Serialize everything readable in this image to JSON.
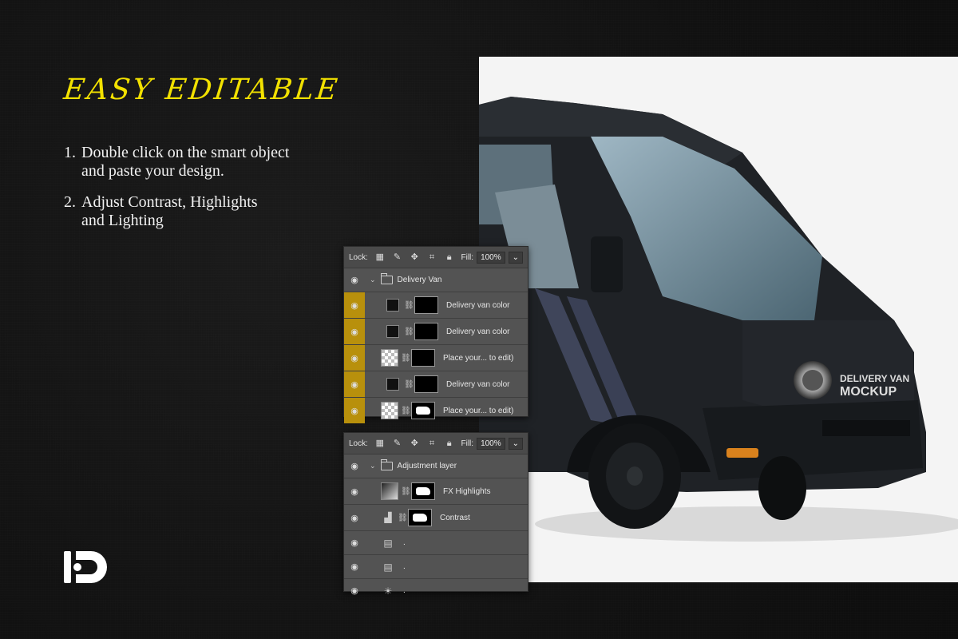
{
  "heading": "EASY EDITABLE",
  "steps": [
    {
      "num": "1.",
      "line1": "Double click on the smart object",
      "line2": "and paste your design."
    },
    {
      "num": "2.",
      "line1": "Adjust Contrast, Highlights",
      "line2": "and Lighting"
    }
  ],
  "van_text": {
    "line1": "DELIVERY VAN",
    "line2": "MOCKUP"
  },
  "panel1": {
    "lock_label": "Lock:",
    "fill_label": "Fill:",
    "fill_value": "100%",
    "group": "Delivery Van",
    "layers": [
      {
        "name": "Delivery van color"
      },
      {
        "name": "Delivery van color"
      },
      {
        "name": "Place your... to edit)"
      },
      {
        "name": "Delivery van color"
      },
      {
        "name": "Place your... to edit)"
      }
    ]
  },
  "panel2": {
    "lock_label": "Lock:",
    "fill_label": "Fill:",
    "fill_value": "100%",
    "group": "Adjustment layer",
    "layers": [
      {
        "name": "FX Highlights"
      },
      {
        "name": "Contrast"
      },
      {
        "name": "."
      },
      {
        "name": "."
      },
      {
        "name": "."
      }
    ]
  },
  "colors": {
    "accent": "#f2e100",
    "highlight": "#b8900c"
  }
}
